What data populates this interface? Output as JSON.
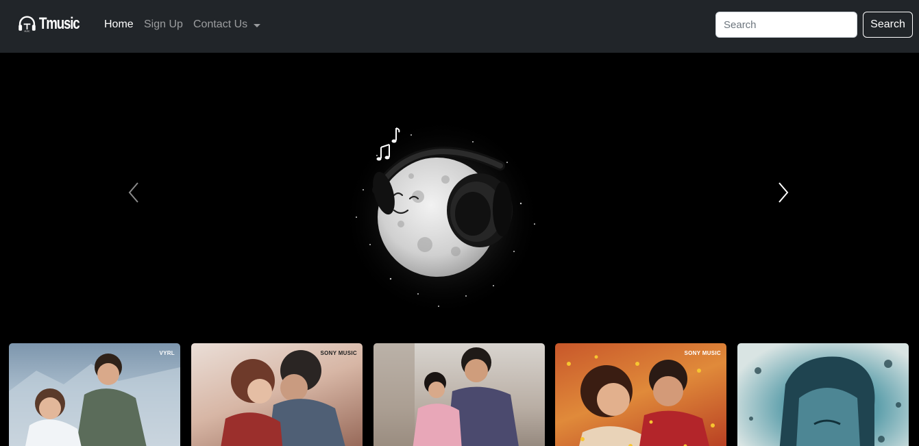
{
  "brand": {
    "name": "Tmusic",
    "logo_caption": "MUSIC"
  },
  "nav": {
    "home": "Home",
    "signup": "Sign Up",
    "contact": "Contact Us"
  },
  "search": {
    "placeholder": "Search",
    "button": "Search"
  },
  "carousel": {
    "prev_icon": "chevron-left-icon",
    "next_icon": "chevron-right-icon"
  },
  "cards": [
    {
      "label": "VYRL"
    },
    {
      "label": "SONY MUSIC"
    },
    {
      "label": ""
    },
    {
      "label": "SONY MUSIC"
    },
    {
      "label": ""
    }
  ],
  "colors": {
    "navbar": "#212529",
    "background": "#000000",
    "accent": "#ffffff"
  }
}
